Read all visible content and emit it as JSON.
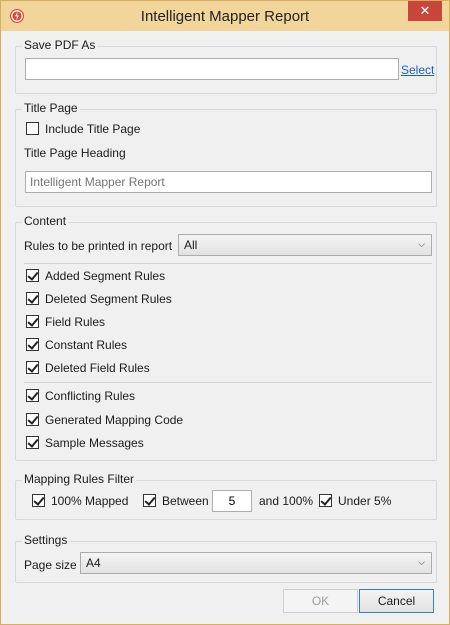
{
  "window": {
    "title": "Intelligent Mapper Report",
    "close_label": "✕"
  },
  "save_pdf": {
    "legend": "Save PDF As",
    "path_value": "",
    "select_link": "Select"
  },
  "title_page": {
    "legend": "Title Page",
    "include_label": "Include Title Page",
    "include_checked": false,
    "heading_label": "Title Page Heading",
    "heading_placeholder": "Intelligent Mapper Report"
  },
  "content": {
    "legend": "Content",
    "rules_label": "Rules to be printed in report",
    "rules_selected": "All",
    "rule_checks": [
      {
        "label": "Added Segment Rules",
        "checked": true
      },
      {
        "label": "Deleted Segment Rules",
        "checked": true
      },
      {
        "label": "Field Rules",
        "checked": true
      },
      {
        "label": "Constant Rules",
        "checked": true
      },
      {
        "label": "Deleted Field Rules",
        "checked": true
      }
    ],
    "extra_checks": [
      {
        "label": "Conflicting Rules",
        "checked": true
      },
      {
        "label": "Generated Mapping Code",
        "checked": true
      },
      {
        "label": "Sample Messages",
        "checked": true
      }
    ]
  },
  "filter": {
    "legend": "Mapping Rules Filter",
    "mapped_label": "100% Mapped",
    "between_label": "Between",
    "between_value": "5",
    "and_label": "and 100%",
    "under_label": "Under 5%"
  },
  "settings": {
    "legend": "Settings",
    "page_size_label": "Page size",
    "page_size_value": "A4"
  },
  "buttons": {
    "ok": "OK",
    "cancel": "Cancel"
  }
}
